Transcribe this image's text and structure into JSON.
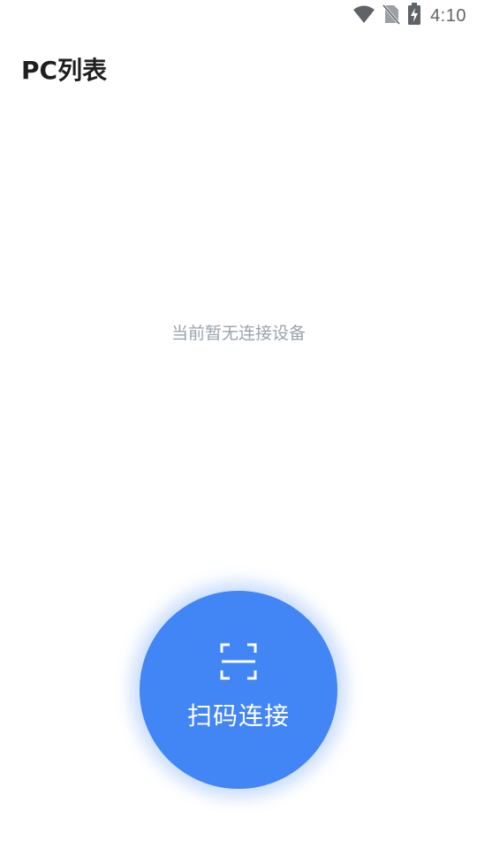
{
  "status_bar": {
    "time": "4:10",
    "icons": [
      "wifi-icon",
      "no-sim-icon",
      "battery-charging-icon"
    ]
  },
  "header": {
    "title": "PC列表"
  },
  "main": {
    "empty_message": "当前暂无连接设备"
  },
  "fab": {
    "icon": "scan-icon",
    "label": "扫码连接"
  },
  "colors": {
    "accent": "#4285f4",
    "empty_text": "#9aa3ad",
    "title_text": "#1f1f1f",
    "status_icons": "#5f6368"
  }
}
